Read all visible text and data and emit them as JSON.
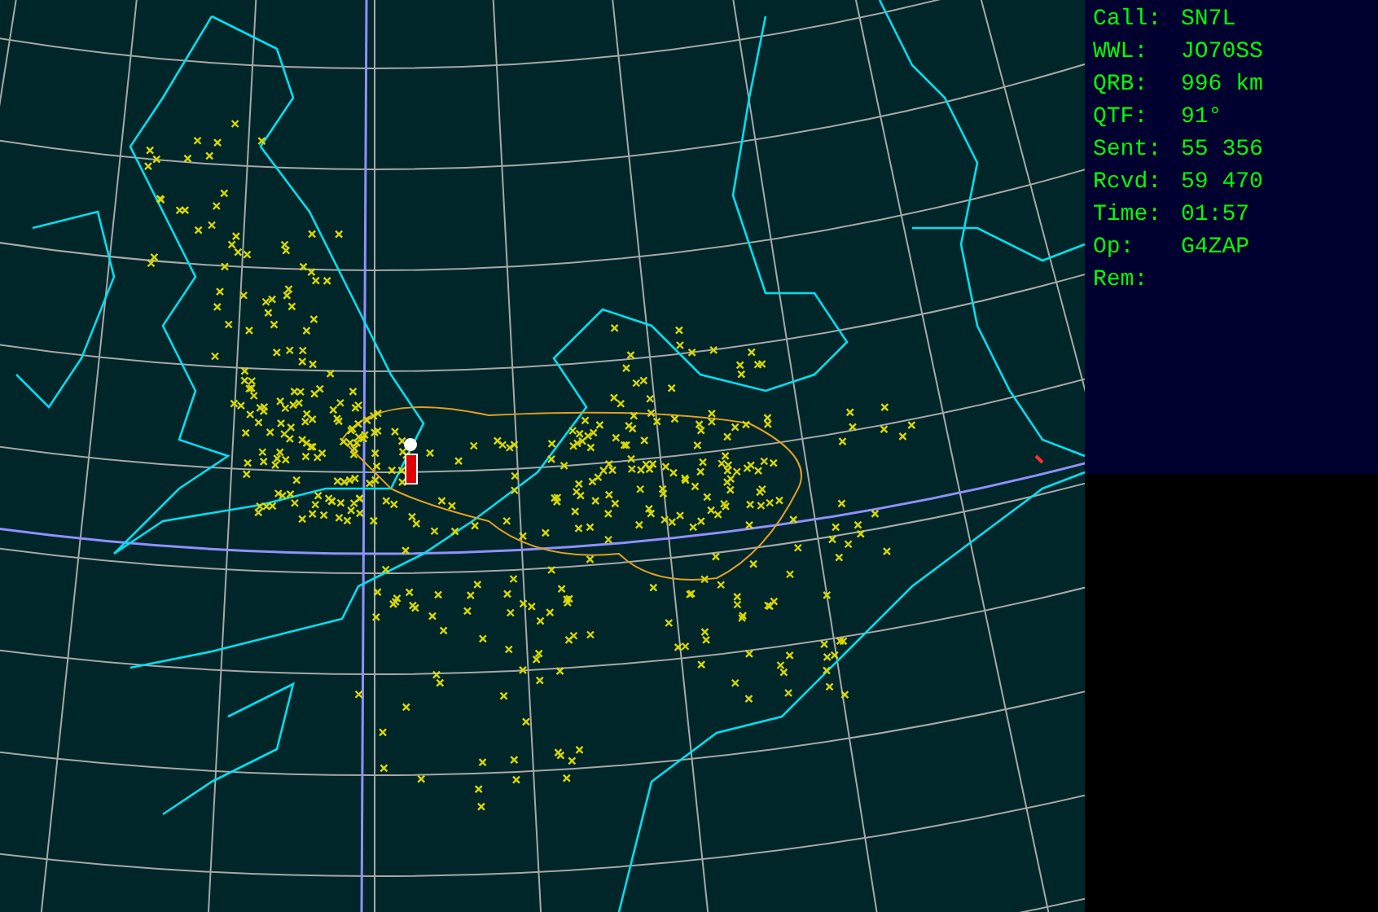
{
  "station_info": [
    {
      "label": "Call:",
      "value": "SN7L"
    },
    {
      "label": "WWL:",
      "value": "JO70SS"
    },
    {
      "label": "QRB:",
      "value": "996 km"
    },
    {
      "label": "QTF:",
      "value": "91°"
    },
    {
      "label": "Sent:",
      "value": "55 356"
    },
    {
      "label": "Rcvd:",
      "value": "59 470"
    },
    {
      "label": "Time:",
      "value": "01:57"
    },
    {
      "label": "Op:",
      "value": "G4ZAP"
    },
    {
      "label": "Rem:"
    }
  ]
}
